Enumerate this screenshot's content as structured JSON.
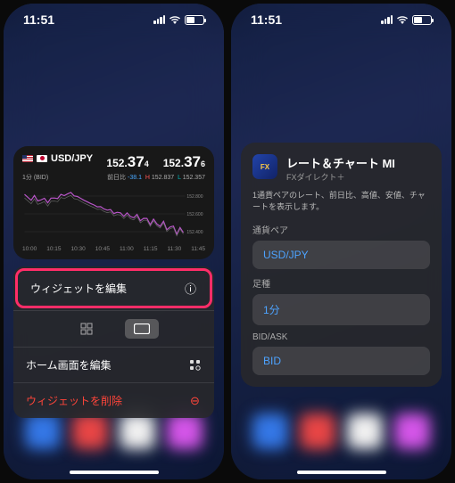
{
  "status": {
    "time": "11:51"
  },
  "left": {
    "widget": {
      "pair": "USD/JPY",
      "bid_int": "152.",
      "bid_big": "37",
      "bid_sub": "4",
      "ask_int": "152.",
      "ask_big": "37",
      "ask_sub": "6",
      "timeframe": "1分 (BID)",
      "delta_label": "前日比",
      "delta_value": "-38.1",
      "high_label": "H",
      "high_value": "152.837",
      "low_label": "L",
      "low_value": "152.357",
      "yaxis_top": "152.800",
      "yaxis_mid": "152.600",
      "yaxis_bot": "152.400",
      "times": [
        "10:00",
        "10:15",
        "10:30",
        "10:45",
        "11:00",
        "11:15",
        "11:30",
        "11:45"
      ]
    },
    "menu": {
      "edit_widget": "ウィジェットを編集",
      "edit_home": "ホーム画面を編集",
      "remove_widget": "ウィジェットを削除"
    }
  },
  "right": {
    "title": "レート＆チャート MI",
    "subtitle": "FXダイレクト＋",
    "description": "1通貨ペアのレート、前日比、高値、安値、チャートを表示します。",
    "fields": {
      "pair_label": "通貨ペア",
      "pair_value": "USD/JPY",
      "period_label": "足種",
      "period_value": "1分",
      "bidask_label": "BID/ASK",
      "bidask_value": "BID"
    }
  },
  "chart_data": {
    "type": "line",
    "x": [
      "10:00",
      "10:15",
      "10:30",
      "10:45",
      "11:00",
      "11:15",
      "11:30",
      "11:45"
    ],
    "values": [
      152.76,
      152.72,
      152.8,
      152.68,
      152.6,
      152.55,
      152.48,
      152.4
    ],
    "ylim": [
      152.35,
      152.84
    ],
    "high": 152.837,
    "low": 152.357,
    "delta": -38.1,
    "xlabel": "",
    "ylabel": ""
  }
}
